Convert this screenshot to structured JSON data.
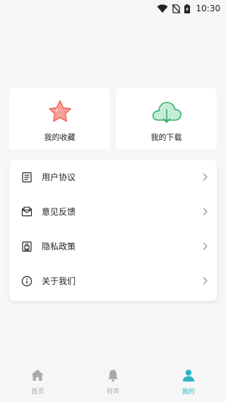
{
  "status_bar": {
    "time": "10:30",
    "icons": [
      "wifi-icon",
      "no-sim-icon",
      "battery-charging-icon"
    ]
  },
  "quick_cards": [
    {
      "label": "我的收藏",
      "icon": "star-icon",
      "color": "#f07a6e"
    },
    {
      "label": "我的下载",
      "icon": "cloud-download-icon",
      "color": "#38b36e"
    }
  ],
  "menu": [
    {
      "label": "用户协议",
      "icon": "document-list-icon"
    },
    {
      "label": "意见反馈",
      "icon": "mail-feedback-icon"
    },
    {
      "label": "隐私政策",
      "icon": "lock-document-icon"
    },
    {
      "label": "关于我们",
      "icon": "info-circle-icon"
    }
  ],
  "bottom_nav": [
    {
      "label": "首页",
      "icon": "home-icon",
      "active": false
    },
    {
      "label": "铃声",
      "icon": "bell-icon",
      "active": false
    },
    {
      "label": "我的",
      "icon": "user-icon",
      "active": true
    }
  ],
  "colors": {
    "accent": "#2bb6c4",
    "inactive": "#aaaaaa",
    "background": "#f6f6f6"
  }
}
